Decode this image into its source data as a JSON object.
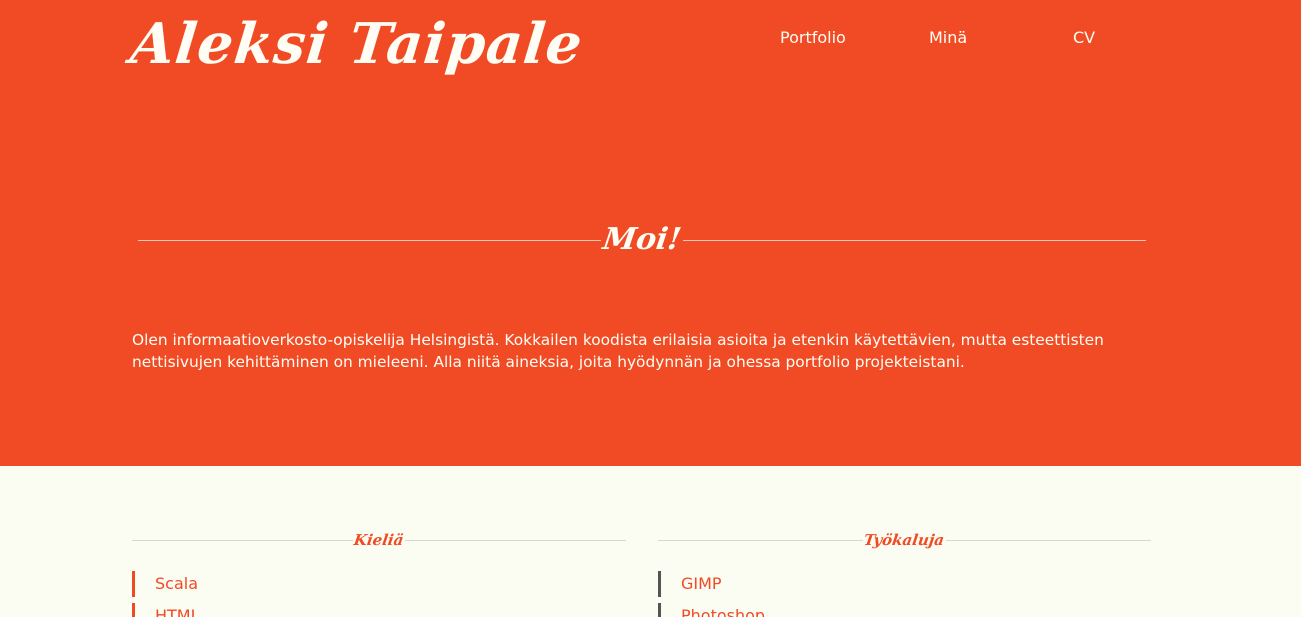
{
  "header": {
    "brand": "Aleksi Taipale",
    "nav": [
      "Portfolio",
      "Minä",
      "CV"
    ]
  },
  "hero": {
    "heading": "Moi!",
    "intro": "Olen informaatioverkosto-opiskelija Helsingistä. Kokkailen koodista erilaisia asioita ja etenkin käytettävien, mutta esteettisten nettisivujen kehittäminen on mieleeni. Alla niitä aineksia, joita hyödynnän ja ohessa portfolio projekteistani."
  },
  "skills": {
    "languages": {
      "heading": "Kieliä",
      "items": [
        "Scala",
        "HTML"
      ]
    },
    "tools": {
      "heading": "Työkaluja",
      "items": [
        "GIMP",
        "Photoshop"
      ]
    }
  },
  "colors": {
    "accent": "#f04b24",
    "background_light": "#fbfcf2",
    "text_light": "#fffdf4",
    "tool_bullet": "#555555"
  }
}
